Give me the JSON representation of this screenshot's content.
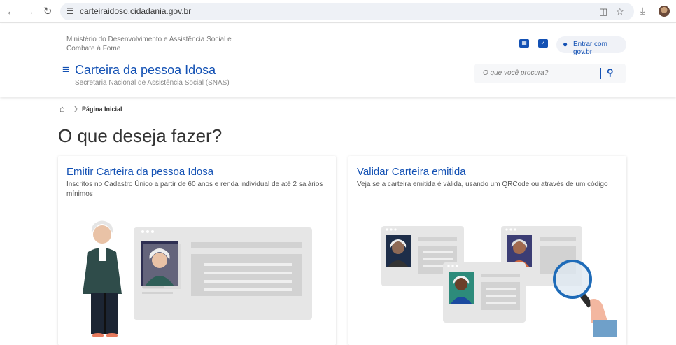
{
  "browser": {
    "url": "carteiraidoso.cidadania.gov.br"
  },
  "header": {
    "ministry": "Ministério do Desenvolvimento e Assistência Social e Combate à Fome",
    "login_label": "Entrar com gov.br",
    "title": "Carteira da pessoa Idosa",
    "subtitle": "Secretaria Nacional de Assistência Social (SNAS)",
    "search_placeholder": "O que você procura?"
  },
  "breadcrumb": {
    "current": "Página Inicial"
  },
  "main": {
    "heading": "O que deseja fazer?",
    "cards": [
      {
        "title": "Emitir Carteira da pessoa Idosa",
        "description": "Inscritos no Cadastro Único a partir de 60 anos e renda individual de até 2 salários mínimos"
      },
      {
        "title": "Validar Carteira emitida",
        "description": "Veja se a carteira emitida é válida, usando um QRCode ou através de um código"
      }
    ]
  },
  "colors": {
    "brand_blue": "#1351b4",
    "illustration_gray": "#e6e6e6"
  }
}
